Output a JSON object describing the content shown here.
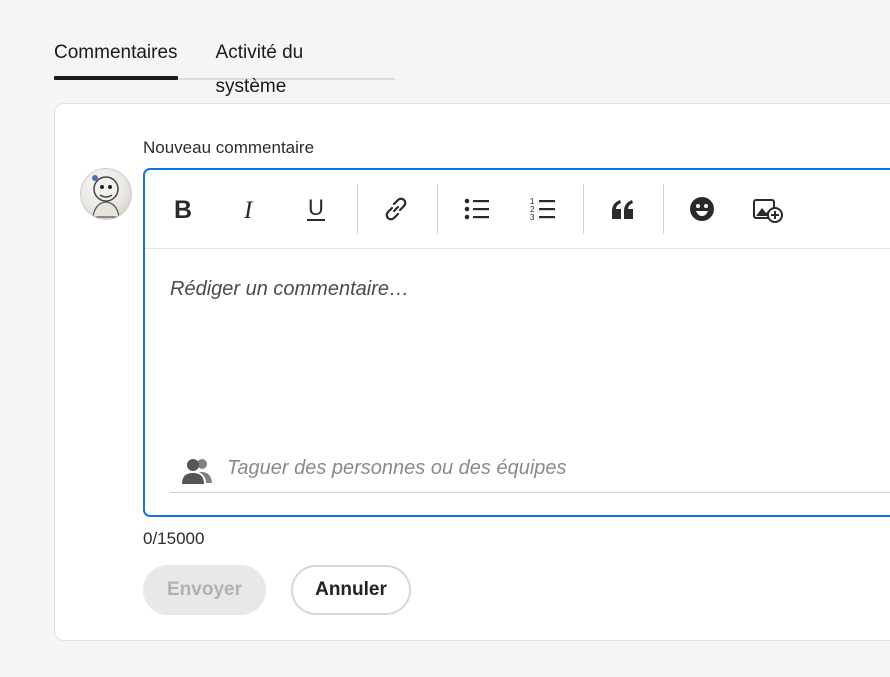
{
  "tabs": [
    {
      "label": "Commentaires",
      "active": true
    },
    {
      "label": "Activité du système",
      "active": false
    }
  ],
  "comment": {
    "label": "Nouveau commentaire",
    "placeholder": "Rédiger un commentaire…",
    "tag_placeholder": "Taguer des personnes ou des équipes",
    "counter": "0/15000",
    "send_label": "Envoyer",
    "cancel_label": "Annuler"
  },
  "toolbar": {
    "bold_icon": "bold-icon",
    "italic_icon": "italic-icon",
    "underline_icon": "underline-icon",
    "link_icon": "link-icon",
    "bullet_list_icon": "bullet-list-icon",
    "numbered_list_icon": "numbered-list-icon",
    "quote_icon": "quote-icon",
    "emoji_icon": "emoji-icon",
    "image_icon": "add-image-icon"
  },
  "colors": {
    "accent": "#1473e6",
    "disabled_bg": "#e8e8e8",
    "disabled_text": "#b1b1b1"
  }
}
